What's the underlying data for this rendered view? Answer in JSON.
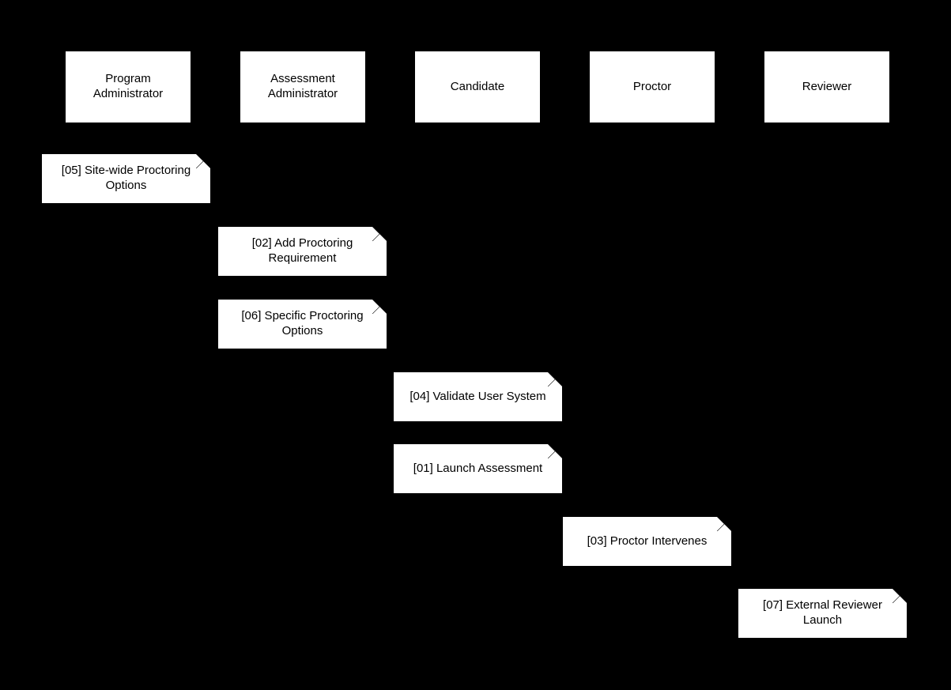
{
  "actors": [
    {
      "label": "Program Administrator"
    },
    {
      "label": "Assessment Administrator"
    },
    {
      "label": "Candidate"
    },
    {
      "label": "Proctor"
    },
    {
      "label": "Reviewer"
    }
  ],
  "steps": [
    {
      "label": "[05] Site-wide Proctoring Options"
    },
    {
      "label": "[02] Add Proctoring Requirement"
    },
    {
      "label": "[06] Specific Proctoring Options"
    },
    {
      "label": "[04] Validate User System"
    },
    {
      "label": "[01] Launch Assessment"
    },
    {
      "label": "[03] Proctor Intervenes"
    },
    {
      "label": "[07] External Reviewer Launch"
    }
  ]
}
